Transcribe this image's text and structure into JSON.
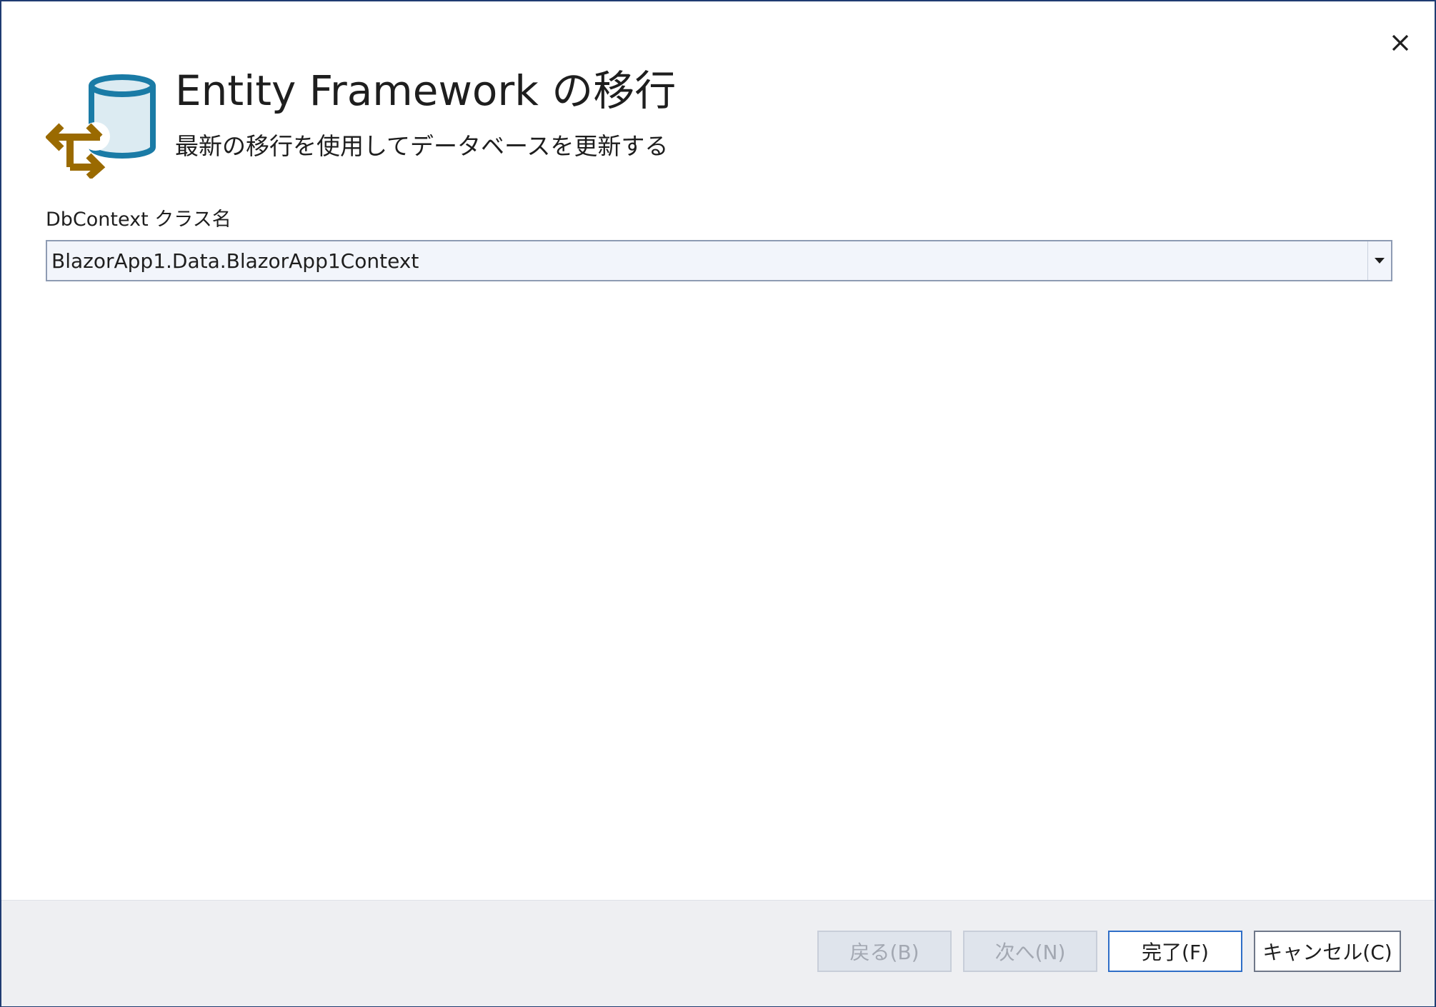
{
  "dialog": {
    "title": "Entity Framework の移行",
    "subtitle": "最新の移行を使用してデータベースを更新する",
    "close_icon": "close-icon",
    "header_icon": "database-migration-icon"
  },
  "form": {
    "dbcontext_label": "DbContext クラス名",
    "dbcontext_value": "BlazorApp1.Data.BlazorApp1Context",
    "dropdown_icon": "chevron-down-icon"
  },
  "footer": {
    "back_label": "戻る(B)",
    "next_label": "次へ(N)",
    "finish_label": "完了(F)",
    "cancel_label": "キャンセル(C)"
  },
  "colors": {
    "db_blue": "#1a7ba6",
    "db_fill": "#dcebf2",
    "arrow_gold": "#9a6a00",
    "accent_border": "#2f6ec7"
  }
}
